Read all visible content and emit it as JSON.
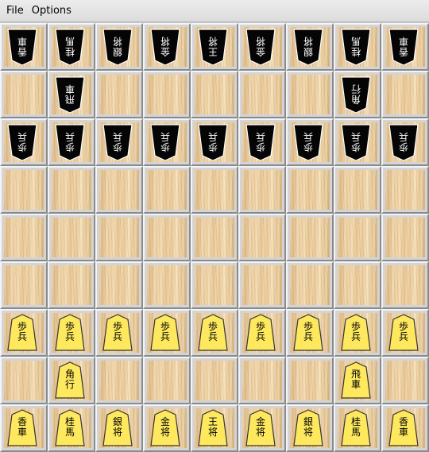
{
  "menu": {
    "file": "File",
    "options": "Options"
  },
  "colors": {
    "sente_fill": "#fde85e",
    "gote_fill": "#050505",
    "outline": "#333333"
  },
  "board": {
    "rows": [
      [
        {
          "side": "gote",
          "chars": [
            "香",
            "車"
          ]
        },
        {
          "side": "gote",
          "chars": [
            "桂",
            "馬"
          ]
        },
        {
          "side": "gote",
          "chars": [
            "銀",
            "将"
          ]
        },
        {
          "side": "gote",
          "chars": [
            "金",
            "将"
          ]
        },
        {
          "side": "gote",
          "chars": [
            "王",
            "将"
          ]
        },
        {
          "side": "gote",
          "chars": [
            "金",
            "将"
          ]
        },
        {
          "side": "gote",
          "chars": [
            "銀",
            "将"
          ]
        },
        {
          "side": "gote",
          "chars": [
            "桂",
            "馬"
          ]
        },
        {
          "side": "gote",
          "chars": [
            "香",
            "車"
          ]
        }
      ],
      [
        null,
        {
          "side": "gote",
          "chars": [
            "飛",
            "車"
          ]
        },
        null,
        null,
        null,
        null,
        null,
        {
          "side": "gote",
          "chars": [
            "角",
            "行"
          ]
        },
        null
      ],
      [
        {
          "side": "gote",
          "chars": [
            "歩",
            "兵"
          ]
        },
        {
          "side": "gote",
          "chars": [
            "歩",
            "兵"
          ]
        },
        {
          "side": "gote",
          "chars": [
            "歩",
            "兵"
          ]
        },
        {
          "side": "gote",
          "chars": [
            "歩",
            "兵"
          ]
        },
        {
          "side": "gote",
          "chars": [
            "歩",
            "兵"
          ]
        },
        {
          "side": "gote",
          "chars": [
            "歩",
            "兵"
          ]
        },
        {
          "side": "gote",
          "chars": [
            "歩",
            "兵"
          ]
        },
        {
          "side": "gote",
          "chars": [
            "歩",
            "兵"
          ]
        },
        {
          "side": "gote",
          "chars": [
            "歩",
            "兵"
          ]
        }
      ],
      [
        null,
        null,
        null,
        null,
        null,
        null,
        null,
        null,
        null
      ],
      [
        null,
        null,
        null,
        null,
        null,
        null,
        null,
        null,
        null
      ],
      [
        null,
        null,
        null,
        null,
        null,
        null,
        null,
        null,
        null
      ],
      [
        {
          "side": "sente",
          "chars": [
            "歩",
            "兵"
          ]
        },
        {
          "side": "sente",
          "chars": [
            "歩",
            "兵"
          ]
        },
        {
          "side": "sente",
          "chars": [
            "歩",
            "兵"
          ]
        },
        {
          "side": "sente",
          "chars": [
            "歩",
            "兵"
          ]
        },
        {
          "side": "sente",
          "chars": [
            "歩",
            "兵"
          ]
        },
        {
          "side": "sente",
          "chars": [
            "歩",
            "兵"
          ]
        },
        {
          "side": "sente",
          "chars": [
            "歩",
            "兵"
          ]
        },
        {
          "side": "sente",
          "chars": [
            "歩",
            "兵"
          ]
        },
        {
          "side": "sente",
          "chars": [
            "歩",
            "兵"
          ]
        }
      ],
      [
        null,
        {
          "side": "sente",
          "chars": [
            "角",
            "行"
          ]
        },
        null,
        null,
        null,
        null,
        null,
        {
          "side": "sente",
          "chars": [
            "飛",
            "車"
          ]
        },
        null
      ],
      [
        {
          "side": "sente",
          "chars": [
            "香",
            "車"
          ]
        },
        {
          "side": "sente",
          "chars": [
            "桂",
            "馬"
          ]
        },
        {
          "side": "sente",
          "chars": [
            "銀",
            "将"
          ]
        },
        {
          "side": "sente",
          "chars": [
            "金",
            "将"
          ]
        },
        {
          "side": "sente",
          "chars": [
            "王",
            "将"
          ]
        },
        {
          "side": "sente",
          "chars": [
            "金",
            "将"
          ]
        },
        {
          "side": "sente",
          "chars": [
            "銀",
            "将"
          ]
        },
        {
          "side": "sente",
          "chars": [
            "桂",
            "馬"
          ]
        },
        {
          "side": "sente",
          "chars": [
            "香",
            "車"
          ]
        }
      ]
    ]
  }
}
